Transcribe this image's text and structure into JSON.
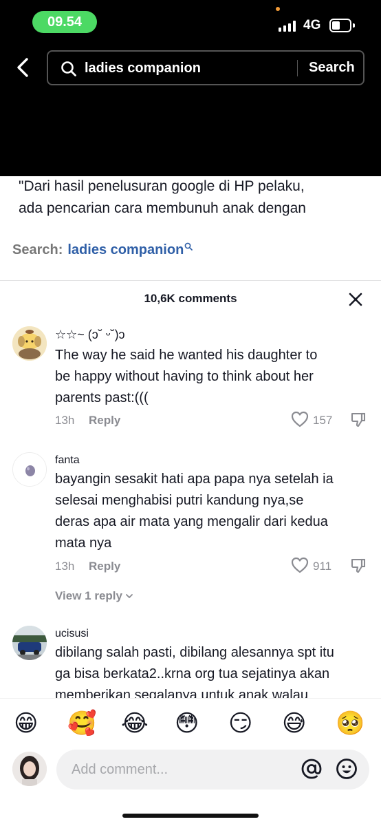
{
  "status_bar": {
    "time": "09.54",
    "network": "4G",
    "battery_color": "#ffffff",
    "time_pill_color": "#4cd964"
  },
  "search": {
    "query": "ladies companion",
    "button_label": "Search"
  },
  "post": {
    "caption_lines": [
      "\"Dari hasil penelusuran google di HP pelaku,",
      "ada pencarian cara membunuh anak dengan"
    ],
    "search_suggestion_label": "Search:",
    "search_suggestion_term": "ladies companion"
  },
  "comments_panel": {
    "count_label": "10,6K comments",
    "comments": [
      {
        "username": "☆☆~ (ɔ˘ ᵕ˘)ɔ",
        "lines": [
          "The way he said he wanted his daughter to",
          "be happy without having to think about her",
          "parents past:((("
        ],
        "time": "13h",
        "reply_label": "Reply",
        "likes": "157"
      },
      {
        "username": "fanta",
        "lines": [
          "bayangin sesakit hati apa papa nya setelah ia",
          "selesai menghabisi putri kandung nya,se",
          "deras apa air mata yang mengalir dari kedua",
          "mata nya"
        ],
        "time": "13h",
        "reply_label": "Reply",
        "likes": "911",
        "view_replies": "View 1 reply"
      },
      {
        "username": "ucisusi",
        "lines": [
          "dibilang salah pasti, dibilang alesannya spt itu",
          "ga bisa berkata2..krna org tua sejatinya akan",
          "memberikan segalanya untuk anak walau"
        ]
      }
    ]
  },
  "emoji_bar": {
    "emojis": [
      "😁",
      "🥰",
      "😂",
      "😳",
      "😏",
      "😅",
      "🥺"
    ]
  },
  "composer": {
    "placeholder": "Add comment...",
    "icons": [
      "at-icon",
      "emoji-icon"
    ]
  }
}
